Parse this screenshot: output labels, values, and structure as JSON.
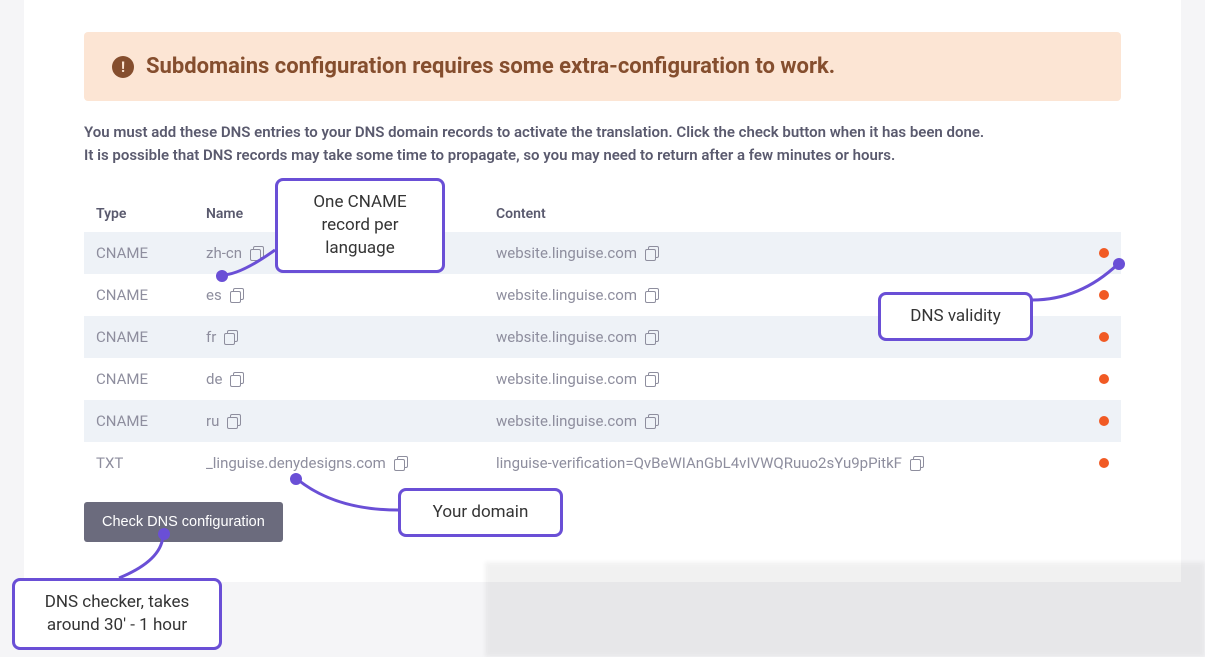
{
  "alert": {
    "title": "Subdomains configuration requires some extra-configuration to work."
  },
  "instructions": {
    "line1": "You must add these DNS entries to your DNS domain records to activate the translation. Click the check button when it has been done.",
    "line2": "It is possible that DNS records may take some time to propagate, so you may need to return after a few minutes or hours."
  },
  "table": {
    "headers": {
      "type": "Type",
      "name": "Name",
      "content": "Content"
    },
    "rows": [
      {
        "type": "CNAME",
        "name": "zh-cn",
        "content": "website.linguise.com",
        "status": "invalid"
      },
      {
        "type": "CNAME",
        "name": "es",
        "content": "website.linguise.com",
        "status": "invalid"
      },
      {
        "type": "CNAME",
        "name": "fr",
        "content": "website.linguise.com",
        "status": "invalid"
      },
      {
        "type": "CNAME",
        "name": "de",
        "content": "website.linguise.com",
        "status": "invalid"
      },
      {
        "type": "CNAME",
        "name": "ru",
        "content": "website.linguise.com",
        "status": "invalid"
      },
      {
        "type": "TXT",
        "name": "_linguise.denydesigns.com",
        "content": "linguise-verification=QvBeWIAnGbL4vIVWQRuuo2sYu9pPitkF",
        "status": "invalid"
      }
    ]
  },
  "button": {
    "check": "Check DNS configuration"
  },
  "annotations": {
    "cname": "One CNAME record per language",
    "validity": "DNS validity",
    "domain": "Your domain",
    "checker": "DNS checker, takes around 30' - 1 hour"
  }
}
